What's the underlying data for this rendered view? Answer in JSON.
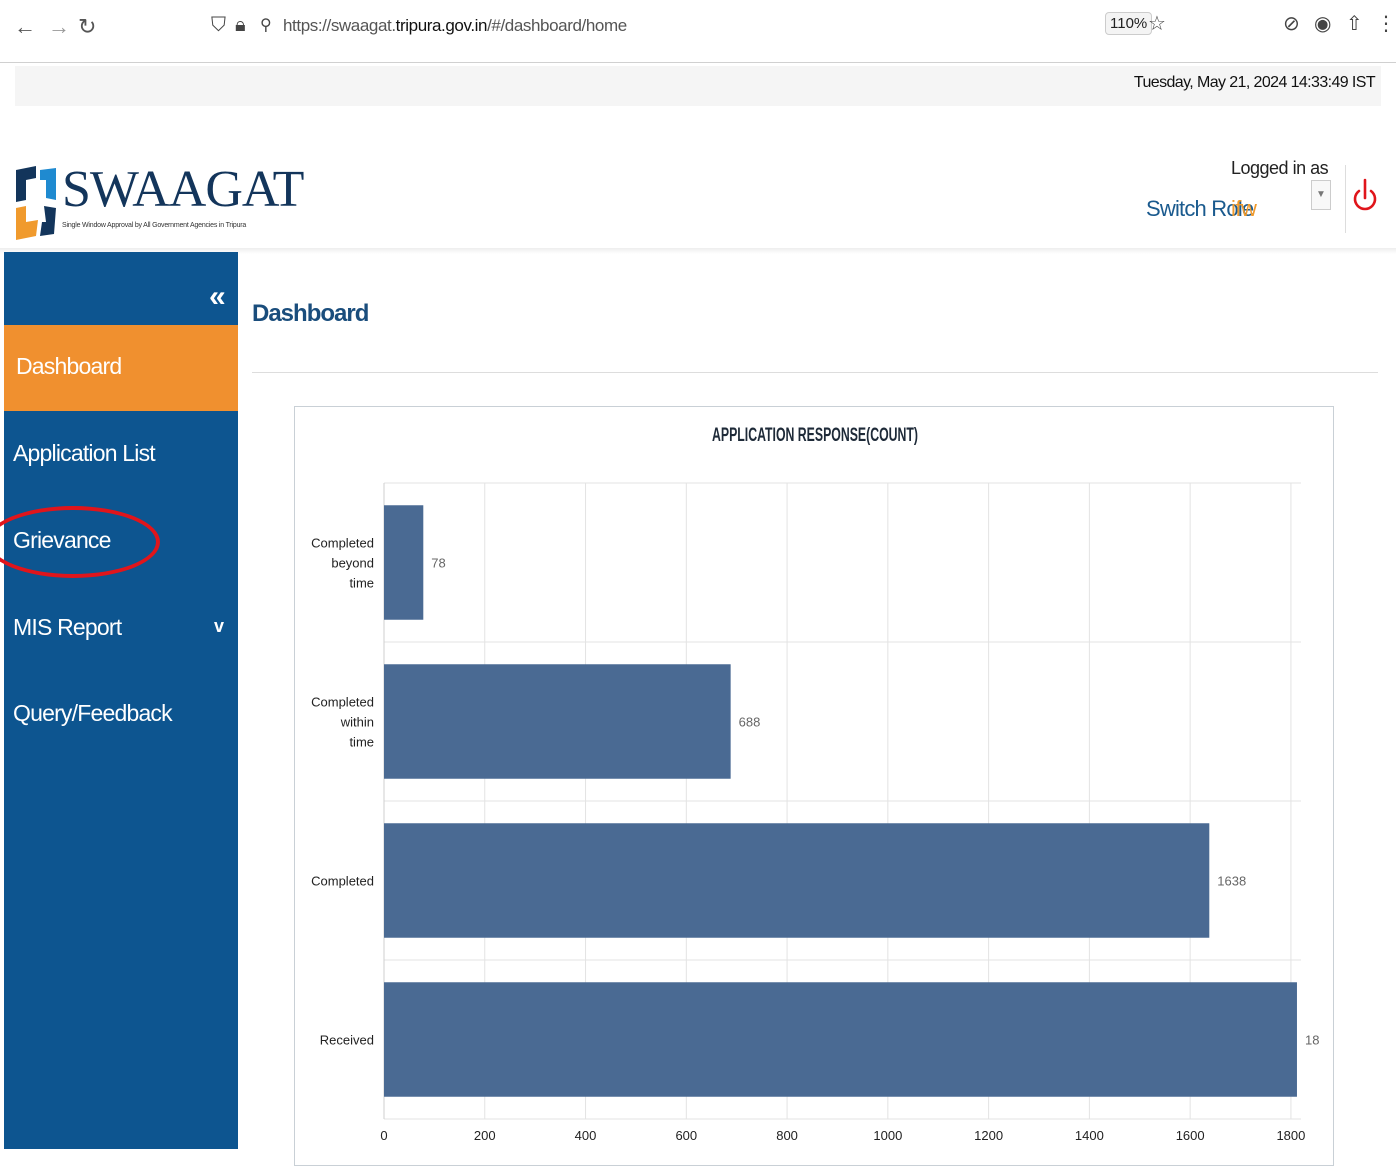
{
  "browser": {
    "url_prefix": "https://swaagat.",
    "url_domain": "tripura.gov.in",
    "url_path": "/#/dashboard/home",
    "zoom": "110%"
  },
  "datetime": "Tuesday, May 21, 2024 14:33:49 IST",
  "header": {
    "logo_text": "SWAAGAT",
    "logo_tagline": "Single Window Approval by All Government Agencies in Tripura",
    "logged_in_label": "Logged in as",
    "switch_role_label": "Switch Role",
    "user": "ifw"
  },
  "sidebar": {
    "collapse_glyph": "«",
    "items": [
      {
        "label": "Dashboard",
        "active": true
      },
      {
        "label": "Application List"
      },
      {
        "label": "Grievance"
      },
      {
        "label": "MIS Report",
        "has_submenu": true
      },
      {
        "label": "Query/Feedback"
      }
    ]
  },
  "main": {
    "page_title": "Dashboard"
  },
  "chart_data": {
    "type": "bar",
    "orientation": "horizontal",
    "title": "APPLICATION RESPONSE(COUNT)",
    "categories": [
      "Completed beyond time",
      "Completed within time",
      "Completed",
      "Received"
    ],
    "values": [
      78,
      688,
      1638,
      1812
    ],
    "data_labels": [
      "78",
      "688",
      "1638",
      "18"
    ],
    "xlim": [
      0,
      1820
    ],
    "xticks": [
      0,
      200,
      400,
      600,
      800,
      1000,
      1200,
      1400,
      1600,
      1800
    ],
    "xtick_labels": [
      "0",
      "200",
      "400",
      "600",
      "800",
      "1000",
      "1200",
      "1400",
      "1600",
      "1800"
    ],
    "bar_color": "#4a6a93",
    "grid": true
  },
  "colors": {
    "sidebar": "#0d5590",
    "active": "#f0902f",
    "accent_circle": "#e0151b"
  }
}
